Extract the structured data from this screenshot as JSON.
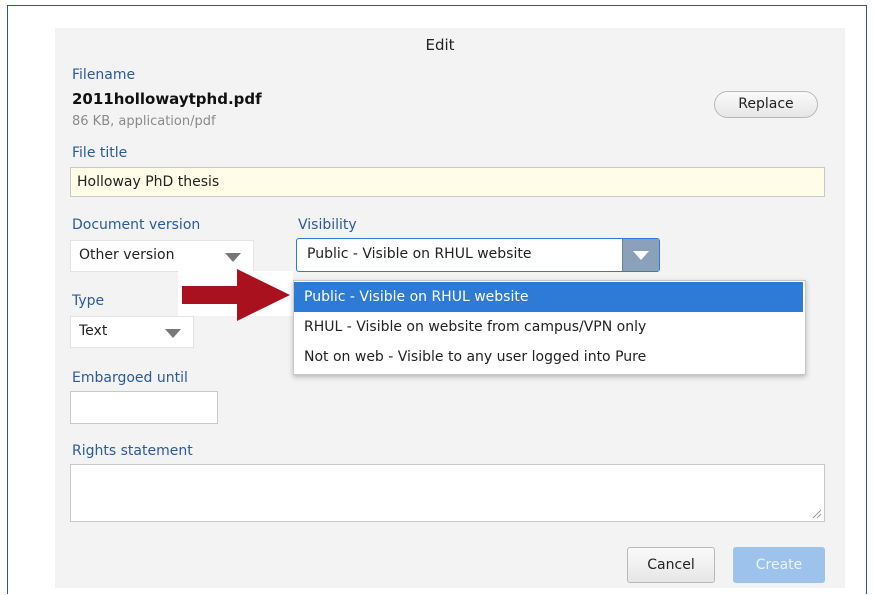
{
  "dialog": {
    "title": "Edit",
    "filename_label": "Filename",
    "filename": "2011hollowaytphd.pdf",
    "file_meta": "86 KB, application/pdf",
    "replace_label": "Replace",
    "file_title_label": "File title",
    "file_title_value": "Holloway PhD thesis",
    "document_version_label": "Document version",
    "document_version_value": "Other version",
    "visibility_label": "Visibility",
    "visibility_value": "Public - Visible on RHUL website",
    "visibility_options": [
      "Public - Visible on RHUL website",
      "RHUL - Visible on website from campus/VPN only",
      "Not on web - Visible to any user logged into Pure"
    ],
    "type_label": "Type",
    "type_value": "Text",
    "embargoed_label": "Embargoed until",
    "embargoed_value": "",
    "rights_label": "Rights statement",
    "rights_value": "",
    "cancel_label": "Cancel",
    "create_label": "Create"
  },
  "colors": {
    "label": "#2a5a9a",
    "highlight": "#2e7bd7",
    "arrow": "#a8111d"
  }
}
